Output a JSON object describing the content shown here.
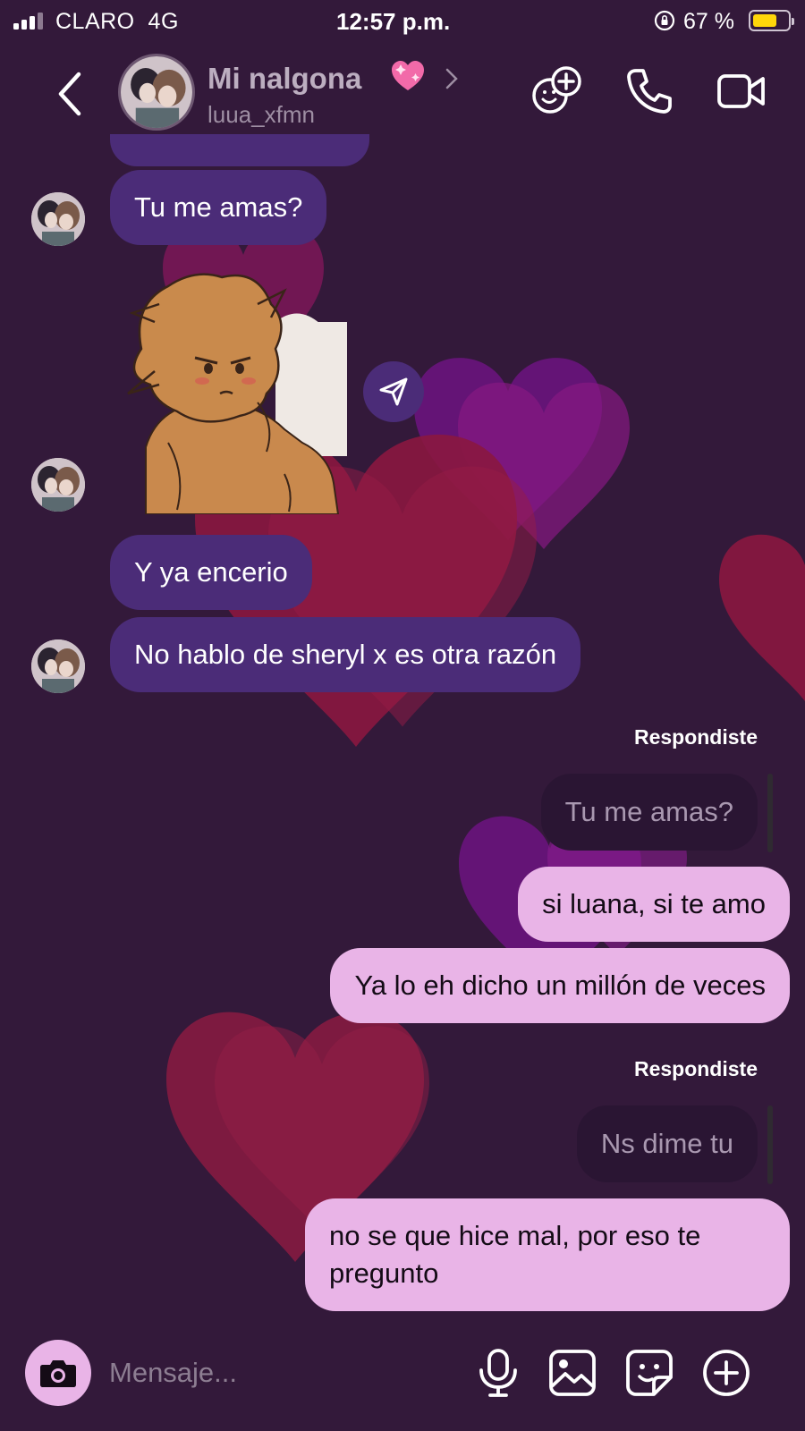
{
  "status_bar": {
    "carrier": "CLARO",
    "network": "4G",
    "time": "12:57 p.m.",
    "battery_percent": "67 %"
  },
  "header": {
    "contact_name": "Mi nalgona",
    "emoji_icon": "sparkling-pink-heart",
    "username": "luua_xfmn"
  },
  "messages": {
    "m1": "Tu me amas?",
    "m2": "Y ya encerio",
    "m3": "No hablo de sheryl x es otra razón",
    "reply1_label": "Respondiste",
    "reply1_quote": "Tu me amas?",
    "m4": "si luana, si te amo",
    "m5": "Ya lo eh dicho un millón de veces",
    "reply2_label": "Respondiste",
    "reply2_quote": "Ns dime tu",
    "m6": "no se que hice mal, por eso te pregunto"
  },
  "composer": {
    "placeholder": "Mensaje..."
  },
  "colors": {
    "background": "#33193a",
    "incoming_bubble": "#4b2c78",
    "outgoing_bubble": "#e9b4e7",
    "battery_fill": "#ffd60a"
  }
}
